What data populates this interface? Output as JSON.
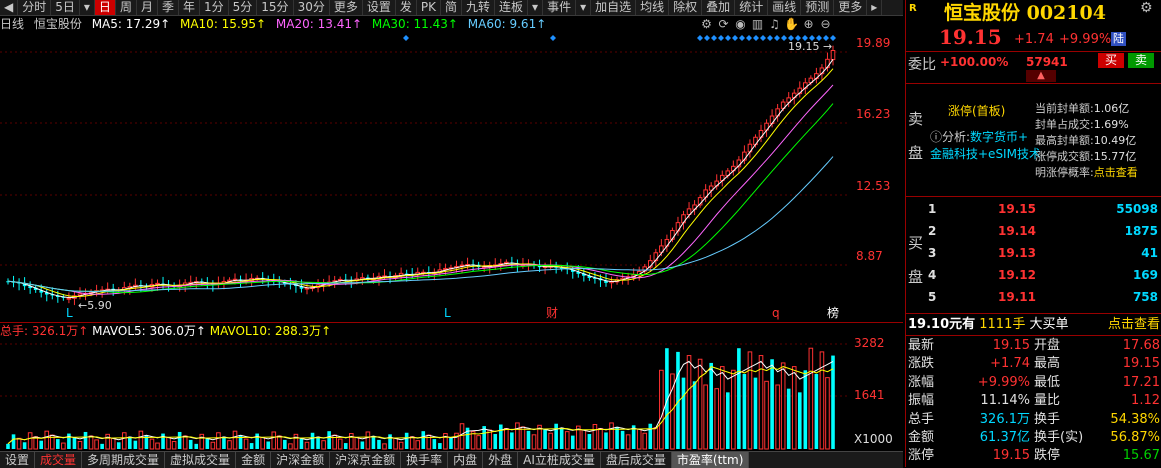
{
  "toolbar": {
    "items": [
      {
        "label": "◀",
        "active": false
      },
      {
        "label": "分时",
        "active": false
      },
      {
        "label": "5日",
        "active": false
      },
      {
        "label": "▾",
        "active": false
      },
      {
        "label": "日",
        "active": true
      },
      {
        "label": "周",
        "active": false
      },
      {
        "label": "月",
        "active": false
      },
      {
        "label": "季",
        "active": false
      },
      {
        "label": "年",
        "active": false
      },
      {
        "label": "1分",
        "active": false
      },
      {
        "label": "5分",
        "active": false
      },
      {
        "label": "15分",
        "active": false
      },
      {
        "label": "30分",
        "active": false
      },
      {
        "label": "更多",
        "active": false
      },
      {
        "label": "设置",
        "active": false
      },
      {
        "label": "发",
        "active": false
      },
      {
        "label": "PK",
        "active": false
      },
      {
        "label": "简",
        "active": false
      },
      {
        "label": "九转",
        "active": false
      },
      {
        "label": "连板",
        "active": false
      },
      {
        "label": "▾",
        "active": false
      },
      {
        "label": "事件",
        "active": false
      },
      {
        "label": "▾",
        "active": false
      },
      {
        "label": "加自选",
        "active": false
      },
      {
        "label": "均线",
        "active": false
      },
      {
        "label": "除权",
        "active": false
      },
      {
        "label": "叠加",
        "active": false
      },
      {
        "label": "统计",
        "active": false
      },
      {
        "label": "画线",
        "active": false
      },
      {
        "label": "预测",
        "active": false
      },
      {
        "label": "更多",
        "active": false
      },
      {
        "label": "▸",
        "active": false
      }
    ]
  },
  "legend": {
    "period": "日线",
    "name": "恒宝股份",
    "ma5": "MA5: 17.29↑",
    "ma10": "MA10: 15.95↑",
    "ma20": "MA20: 13.41↑",
    "ma30": "MA30: 11.43↑",
    "ma60": "MA60: 9.61↑"
  },
  "colors": {
    "ma5": "#ffffff",
    "ma10": "#ffff00",
    "ma20": "#ff66ff",
    "ma30": "#00ff00",
    "ma60": "#66ccff",
    "up": "#ff3232",
    "down": "#00ffff"
  },
  "price_axis": {
    "ticks": [
      "19.89",
      "16.23",
      "12.53",
      "8.87"
    ]
  },
  "price_chart": {
    "high_label": "19.15",
    "low_label": "5.90",
    "markers": [
      "L",
      "L",
      "财",
      "q",
      "榜"
    ]
  },
  "volume": {
    "legend_total": "总手: 326.1万↑",
    "legend_mavol5": "MAVOL5: 306.0万↑",
    "legend_mavol10": "MAVOL10: 288.3万↑",
    "ticks": [
      "3282",
      "1641"
    ],
    "unit": "X1000"
  },
  "chart_data": {
    "type": "candlestick",
    "y_ticks": [
      19.89,
      16.23,
      12.53,
      8.87
    ],
    "high": 19.15,
    "low": 5.9,
    "close": [
      7.2,
      7.1,
      6.9,
      6.7,
      6.5,
      6.4,
      6.3,
      6.5,
      6.6,
      6.7,
      6.8,
      6.7,
      6.9,
      7.0,
      6.9,
      7.1,
      7.0,
      6.9,
      7.1,
      7.2,
      7.1,
      7.0,
      7.2,
      7.3,
      7.2,
      7.4,
      7.3,
      7.2,
      7.1,
      7.0,
      6.8,
      6.9,
      7.1,
      7.2,
      7.3,
      7.2,
      7.4,
      7.3,
      7.5,
      7.4,
      7.6,
      7.5,
      7.7,
      7.6,
      7.8,
      7.9,
      8.0,
      8.1,
      7.9,
      8.0,
      8.1,
      8.2,
      8.0,
      8.1,
      7.9,
      8.0,
      7.9,
      7.8,
      7.6,
      7.4,
      7.3,
      7.1,
      7.3,
      7.4,
      7.6,
      8.0,
      8.7,
      9.3,
      10.1,
      10.8,
      11.2,
      11.9,
      12.3,
      12.8,
      13.2,
      13.9,
      14.6,
      15.2,
      15.9,
      16.5,
      16.9,
      17.4,
      17.8,
      18.3,
      19.15
    ],
    "volume_max": 3282
  },
  "right_panel": {
    "code_tag": "R",
    "title": "恒宝股份 002104",
    "price": "19.15",
    "change": "+1.74",
    "pct": "+9.99%",
    "board": "陆",
    "weibi_label": "委比",
    "weibi": "+100.00%",
    "weicha": "57941",
    "sell_btn": "买",
    "buy_btn": "卖",
    "sell_side_label": [
      "卖",
      "盘"
    ],
    "limit_title": "涨停(首板)",
    "analysis_prefix": "ⓘ分析:",
    "analysis_tags": "数字货币+",
    "analysis_tags2": "金融科技+eSIM技术",
    "stats": [
      {
        "label": "当前封单额:",
        "value": "1.06亿"
      },
      {
        "label": "封单占成交:",
        "value": "1.69%"
      },
      {
        "label": "最高封单额:",
        "value": "10.49亿"
      },
      {
        "label": "涨停成交额:",
        "value": "15.77亿"
      },
      {
        "label": "明涨停概率:",
        "value": "点击查看"
      }
    ],
    "buy_side_label": [
      "买",
      "盘"
    ],
    "bids": [
      {
        "level": "1",
        "price": "19.15",
        "vol": "55098"
      },
      {
        "level": "2",
        "price": "19.14",
        "vol": "1875"
      },
      {
        "level": "3",
        "price": "19.13",
        "vol": "41"
      },
      {
        "level": "4",
        "price": "19.12",
        "vol": "169"
      },
      {
        "level": "5",
        "price": "19.11",
        "vol": "758"
      }
    ],
    "bigorder": {
      "price": "19.10元有",
      "qty": "1111手",
      "label": "大买单",
      "link": "点击查看"
    },
    "quotes": [
      {
        "l": "最新",
        "v": "19.15",
        "vc": "red",
        "l2": "开盘",
        "v2": "17.68",
        "v2c": "red"
      },
      {
        "l": "涨跌",
        "v": "+1.74",
        "vc": "red",
        "l2": "最高",
        "v2": "19.15",
        "v2c": "red"
      },
      {
        "l": "涨幅",
        "v": "+9.99%",
        "vc": "red",
        "l2": "最低",
        "v2": "17.21",
        "v2c": "red"
      },
      {
        "l": "振幅",
        "v": "11.14%",
        "vc": "white",
        "l2": "量比",
        "v2": "1.12",
        "v2c": "red"
      },
      {
        "l": "总手",
        "v": "326.1万",
        "vc": "cyan",
        "l2": "换手",
        "v2": "54.38%",
        "v2c": "yellow"
      },
      {
        "l": "金额",
        "v": "61.37亿",
        "vc": "cyan",
        "l2": "换手(实)",
        "v2": "56.87%",
        "v2c": "yellow"
      },
      {
        "l": "涨停",
        "v": "19.15",
        "vc": "red",
        "l2": "跌停",
        "v2": "15.67",
        "v2c": "green"
      }
    ]
  },
  "bottom_tabs": [
    {
      "label": "设置",
      "state": ""
    },
    {
      "label": "成交量",
      "state": "active"
    },
    {
      "label": "多周期成交量",
      "state": ""
    },
    {
      "label": "虚拟成交量",
      "state": ""
    },
    {
      "label": "金额",
      "state": ""
    },
    {
      "label": "沪深金额",
      "state": ""
    },
    {
      "label": "沪深京金额",
      "state": ""
    },
    {
      "label": "换手率",
      "state": ""
    },
    {
      "label": "内盘",
      "state": ""
    },
    {
      "label": "外盘",
      "state": ""
    },
    {
      "label": "AI立桩成交量",
      "state": ""
    },
    {
      "label": "盘后成交量",
      "state": ""
    },
    {
      "label": "市盈率(ttm)",
      "state": "sel"
    }
  ]
}
